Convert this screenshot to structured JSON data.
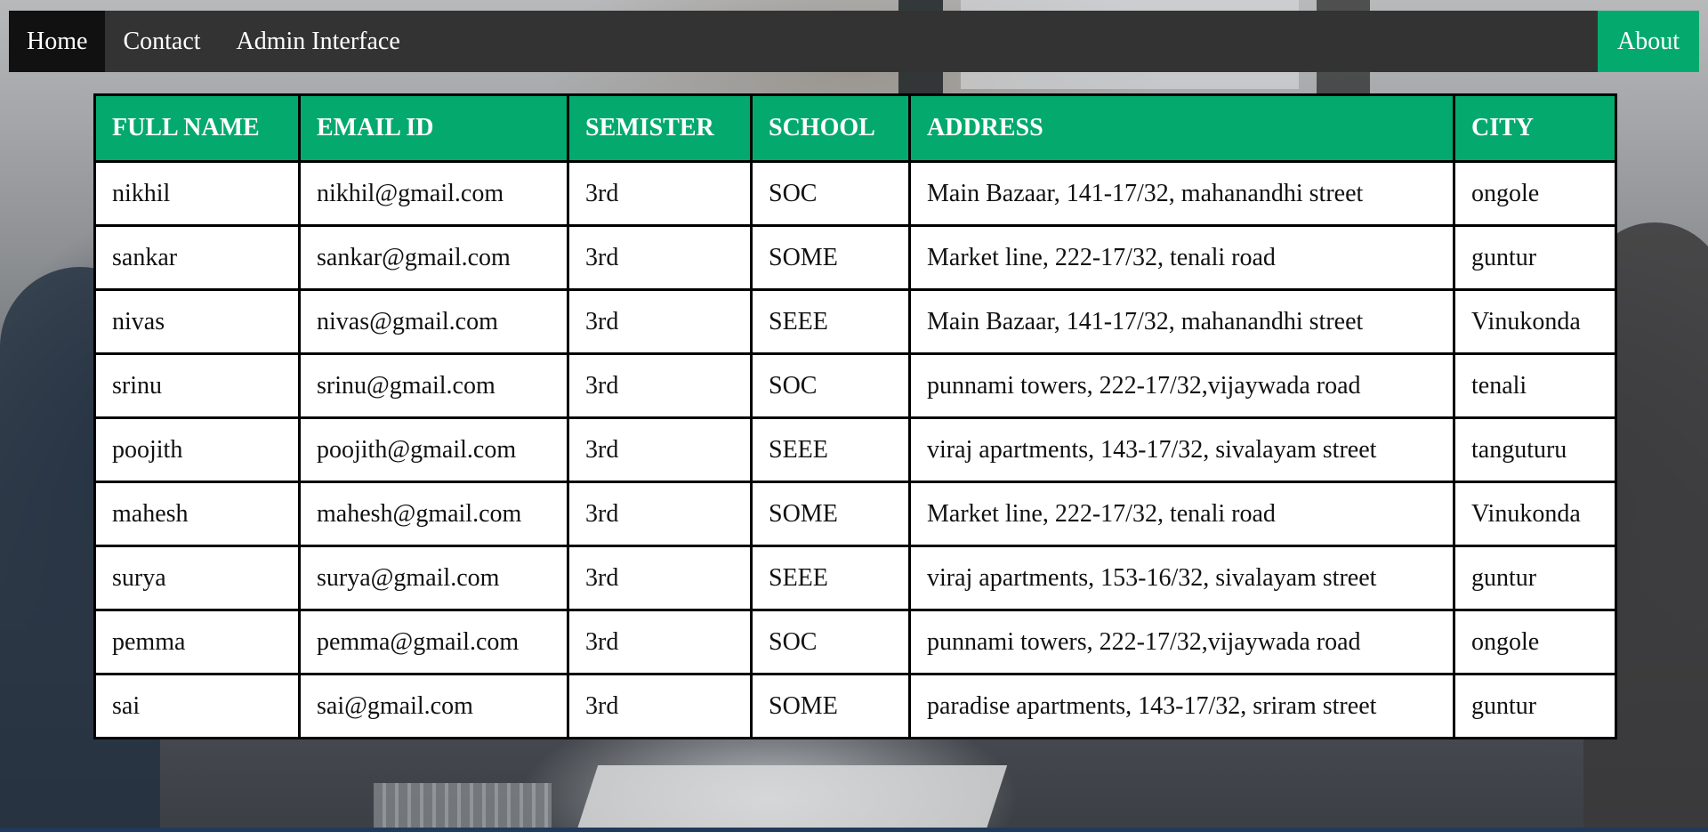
{
  "nav": {
    "items": [
      {
        "label": "Home",
        "active": true
      },
      {
        "label": "Contact",
        "active": false
      },
      {
        "label": "Admin Interface",
        "active": false
      }
    ],
    "about_label": "About"
  },
  "colors": {
    "accent": "#04AA6D",
    "navbar": "#333333",
    "nav_active": "#111111"
  },
  "table": {
    "headers": [
      "FULL NAME",
      "EMAIL ID",
      "SEMISTER",
      "SCHOOL",
      "ADDRESS",
      "CITY"
    ],
    "rows": [
      [
        "nikhil",
        "nikhil@gmail.com",
        "3rd",
        "SOC",
        "Main Bazaar, 141-17/32, mahanandhi street",
        "ongole"
      ],
      [
        "sankar",
        "sankar@gmail.com",
        "3rd",
        "SOME",
        "Market line, 222-17/32, tenali road",
        "guntur"
      ],
      [
        "nivas",
        "nivas@gmail.com",
        "3rd",
        "SEEE",
        "Main Bazaar, 141-17/32, mahanandhi street",
        "Vinukonda"
      ],
      [
        "srinu",
        "srinu@gmail.com",
        "3rd",
        "SOC",
        "punnami towers, 222-17/32,vijaywada road",
        "tenali"
      ],
      [
        "poojith",
        "poojith@gmail.com",
        "3rd",
        "SEEE",
        "viraj apartments, 143-17/32, sivalayam street",
        "tanguturu"
      ],
      [
        "mahesh",
        "mahesh@gmail.com",
        "3rd",
        "SOME",
        "Market line, 222-17/32, tenali road",
        "Vinukonda"
      ],
      [
        "surya",
        "surya@gmail.com",
        "3rd",
        "SEEE",
        "viraj apartments, 153-16/32, sivalayam street",
        "guntur"
      ],
      [
        "pemma",
        "pemma@gmail.com",
        "3rd",
        "SOC",
        "punnami towers, 222-17/32,vijaywada road",
        "ongole"
      ],
      [
        "sai",
        "sai@gmail.com",
        "3rd",
        "SOME",
        "paradise apartments, 143-17/32, sriram street",
        "guntur"
      ]
    ]
  }
}
